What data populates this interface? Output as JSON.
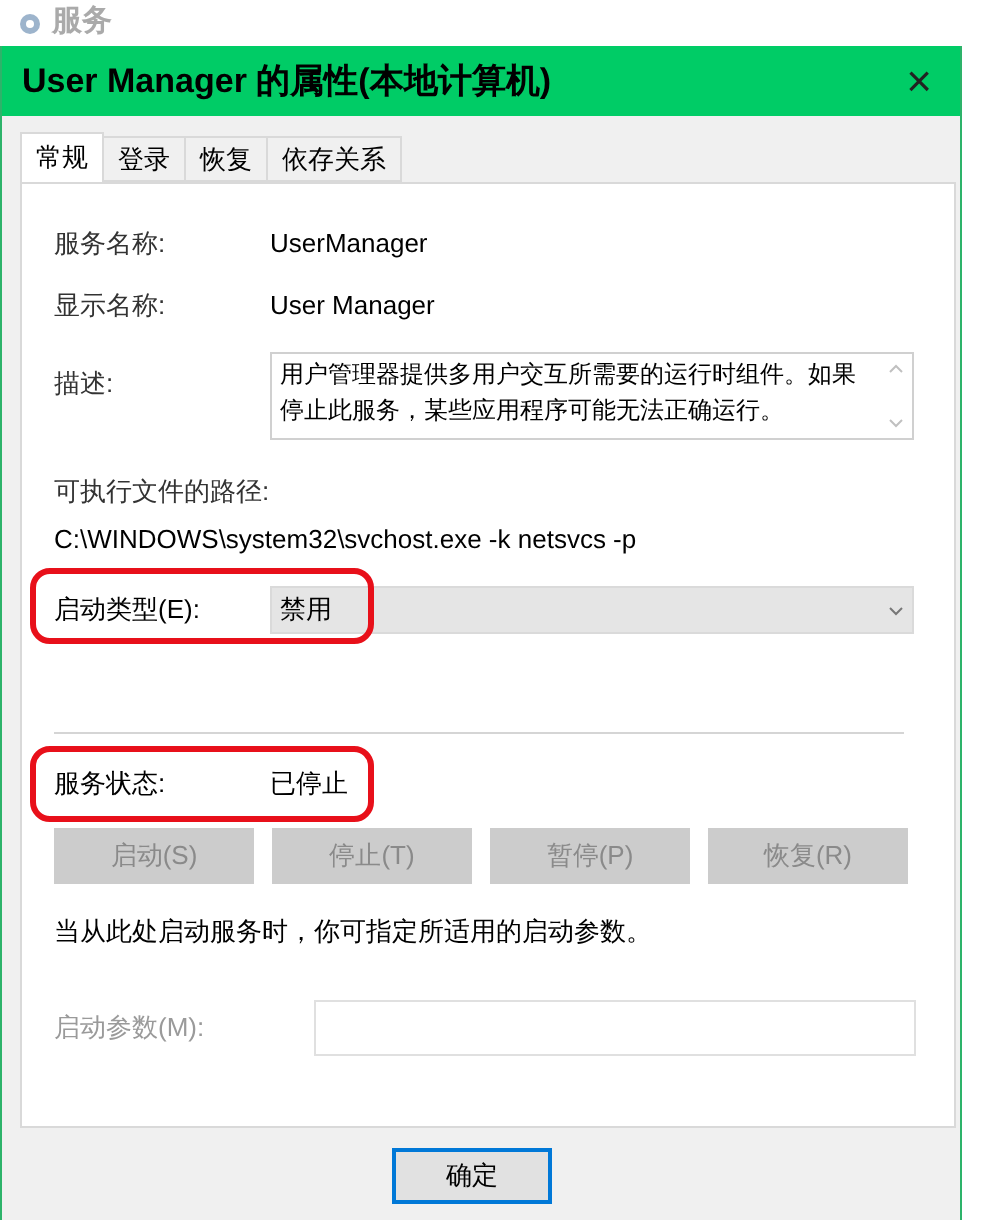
{
  "background_window": {
    "title": "服务"
  },
  "dialog": {
    "title": "User Manager 的属性(本地计算机)",
    "close": "×"
  },
  "tabs": [
    {
      "label": "常规",
      "selected": true
    },
    {
      "label": "登录",
      "selected": false
    },
    {
      "label": "恢复",
      "selected": false
    },
    {
      "label": "依存关系",
      "selected": false
    }
  ],
  "fields": [
    {
      "label": "服务名称:",
      "value": "UserManager"
    },
    {
      "label": "显示名称:",
      "value": "User Manager"
    }
  ],
  "description": {
    "label": "描述:",
    "value": "用户管理器提供多用户交互所需要的运行时组件。如果停止此服务，某些应用程序可能无法正确运行。"
  },
  "path": {
    "label": "可执行文件的路径:",
    "value": "C:\\WINDOWS\\system32\\svchost.exe -k netsvcs -p"
  },
  "startup_type": {
    "label": "启动类型(E):",
    "value": "禁用",
    "highlighted": true
  },
  "service_status": {
    "label": "服务状态:",
    "value": "已停止",
    "highlighted": true
  },
  "service_buttons": [
    {
      "label": "启动(S)",
      "disabled": true
    },
    {
      "label": "停止(T)",
      "disabled": true
    },
    {
      "label": "暂停(P)",
      "disabled": true
    },
    {
      "label": "恢复(R)",
      "disabled": true
    }
  ],
  "hint": "当从此处启动服务时，你可指定所适用的启动参数。",
  "start_parameters": {
    "label": "启动参数(M):",
    "disabled": true
  },
  "footer_buttons": [
    {
      "label": "确定",
      "selected": true
    }
  ]
}
